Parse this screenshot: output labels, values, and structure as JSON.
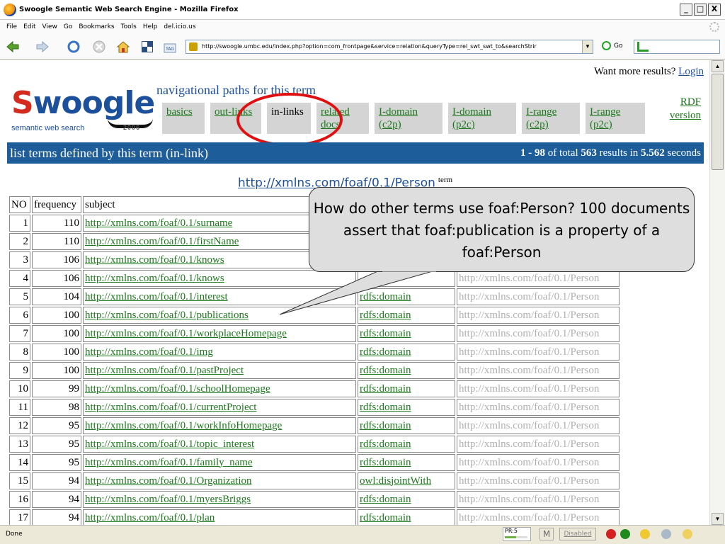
{
  "window": {
    "title": "Swoogle Semantic Web Search Engine - Mozilla Firefox",
    "min": "_",
    "max": "□",
    "close": "X"
  },
  "menu": [
    "File",
    "Edit",
    "View",
    "Go",
    "Bookmarks",
    "Tools",
    "Help",
    "del.icio.us"
  ],
  "toolbar": {
    "url": "http://swoogle.umbc.edu/index.php?option=com_frontpage&service=relation&queryType=rel_swt_swt_to&searchStrir",
    "go_label": "Go"
  },
  "page": {
    "logo_text": [
      "S",
      "w",
      "o",
      "o",
      "g",
      "l",
      "e"
    ],
    "logo_sub": "semantic web search",
    "logo_year": "2006",
    "nav_label": "navigational paths for this term",
    "want_more": "Want more results?",
    "login": "Login",
    "tabs": [
      {
        "line1": "basics",
        "line2": ""
      },
      {
        "line1": "out-links",
        "line2": ""
      },
      {
        "line1": "in-links",
        "line2": ""
      },
      {
        "line1": "related",
        "line2": "docs"
      },
      {
        "line1": "I-domain",
        "line2": "(c2p)"
      },
      {
        "line1": "I-domain",
        "line2": "(p2c)"
      },
      {
        "line1": "I-range",
        "line2": "(c2p)"
      },
      {
        "line1": "I-range",
        "line2": "(p2c)"
      }
    ],
    "rdf_line1": "RDF",
    "rdf_line2": "version",
    "header_left": "list terms defined by this term (in-link)",
    "header_range": "1 - 98",
    "header_of_total": "of total",
    "header_total": "563",
    "header_results_in": "results in",
    "header_time": "5.562",
    "header_seconds": "seconds",
    "term_url": "http://xmlns.com/foaf/0.1/Person",
    "term_sup": "term",
    "columns": [
      "NO",
      "frequency",
      "subject"
    ],
    "rows": [
      {
        "no": "1",
        "freq": "110",
        "subject": "http://xmlns.com/foaf/0.1/surname",
        "pred": "",
        "obj": ""
      },
      {
        "no": "2",
        "freq": "110",
        "subject": "http://xmlns.com/foaf/0.1/firstName",
        "pred": "",
        "obj": ""
      },
      {
        "no": "3",
        "freq": "106",
        "subject": "http://xmlns.com/foaf/0.1/knows",
        "pred": "",
        "obj": ""
      },
      {
        "no": "4",
        "freq": "106",
        "subject": "http://xmlns.com/foaf/0.1/knows",
        "pred": "",
        "obj": "http://xmlns.com/foaf/0.1/Person"
      },
      {
        "no": "5",
        "freq": "104",
        "subject": "http://xmlns.com/foaf/0.1/interest",
        "pred": "rdfs:domain",
        "obj": "http://xmlns.com/foaf/0.1/Person"
      },
      {
        "no": "6",
        "freq": "100",
        "subject": "http://xmlns.com/foaf/0.1/publications",
        "pred": "rdfs:domain",
        "obj": "http://xmlns.com/foaf/0.1/Person"
      },
      {
        "no": "7",
        "freq": "100",
        "subject": "http://xmlns.com/foaf/0.1/workplaceHomepage",
        "pred": "rdfs:domain",
        "obj": "http://xmlns.com/foaf/0.1/Person"
      },
      {
        "no": "8",
        "freq": "100",
        "subject": "http://xmlns.com/foaf/0.1/img",
        "pred": "rdfs:domain",
        "obj": "http://xmlns.com/foaf/0.1/Person"
      },
      {
        "no": "9",
        "freq": "100",
        "subject": "http://xmlns.com/foaf/0.1/pastProject",
        "pred": "rdfs:domain",
        "obj": "http://xmlns.com/foaf/0.1/Person"
      },
      {
        "no": "10",
        "freq": "99",
        "subject": "http://xmlns.com/foaf/0.1/schoolHomepage",
        "pred": "rdfs:domain",
        "obj": "http://xmlns.com/foaf/0.1/Person"
      },
      {
        "no": "11",
        "freq": "98",
        "subject": "http://xmlns.com/foaf/0.1/currentProject",
        "pred": "rdfs:domain",
        "obj": "http://xmlns.com/foaf/0.1/Person"
      },
      {
        "no": "12",
        "freq": "95",
        "subject": "http://xmlns.com/foaf/0.1/workInfoHomepage",
        "pred": "rdfs:domain",
        "obj": "http://xmlns.com/foaf/0.1/Person"
      },
      {
        "no": "13",
        "freq": "95",
        "subject": "http://xmlns.com/foaf/0.1/topic_interest",
        "pred": "rdfs:domain",
        "obj": "http://xmlns.com/foaf/0.1/Person"
      },
      {
        "no": "14",
        "freq": "95",
        "subject": "http://xmlns.com/foaf/0.1/family_name",
        "pred": "rdfs:domain",
        "obj": "http://xmlns.com/foaf/0.1/Person"
      },
      {
        "no": "15",
        "freq": "94",
        "subject": "http://xmlns.com/foaf/0.1/Organization",
        "pred": "owl:disjointWith",
        "obj": "http://xmlns.com/foaf/0.1/Person"
      },
      {
        "no": "16",
        "freq": "94",
        "subject": "http://xmlns.com/foaf/0.1/myersBriggs",
        "pred": "rdfs:domain",
        "obj": "http://xmlns.com/foaf/0.1/Person"
      },
      {
        "no": "17",
        "freq": "94",
        "subject": "http://xmlns.com/foaf/0.1/plan",
        "pred": "rdfs:domain",
        "obj": "http://xmlns.com/foaf/0.1/Person"
      }
    ],
    "callout": "How do other terms use foaf:Person? 100 documents assert that foaf:publication is a property of a foaf:Person"
  },
  "status": {
    "done": "Done",
    "pagerank_label": "PR:5",
    "pagerank_fraction": 0.5,
    "gmail": "M",
    "disabled": "Disabled"
  },
  "colors": {
    "header_bar": "#1d5d9a",
    "link_green": "#1c7a1c",
    "logo_red": "#d52a1e",
    "logo_blue": "#1c4f9c",
    "circle_red": "#e01010"
  }
}
